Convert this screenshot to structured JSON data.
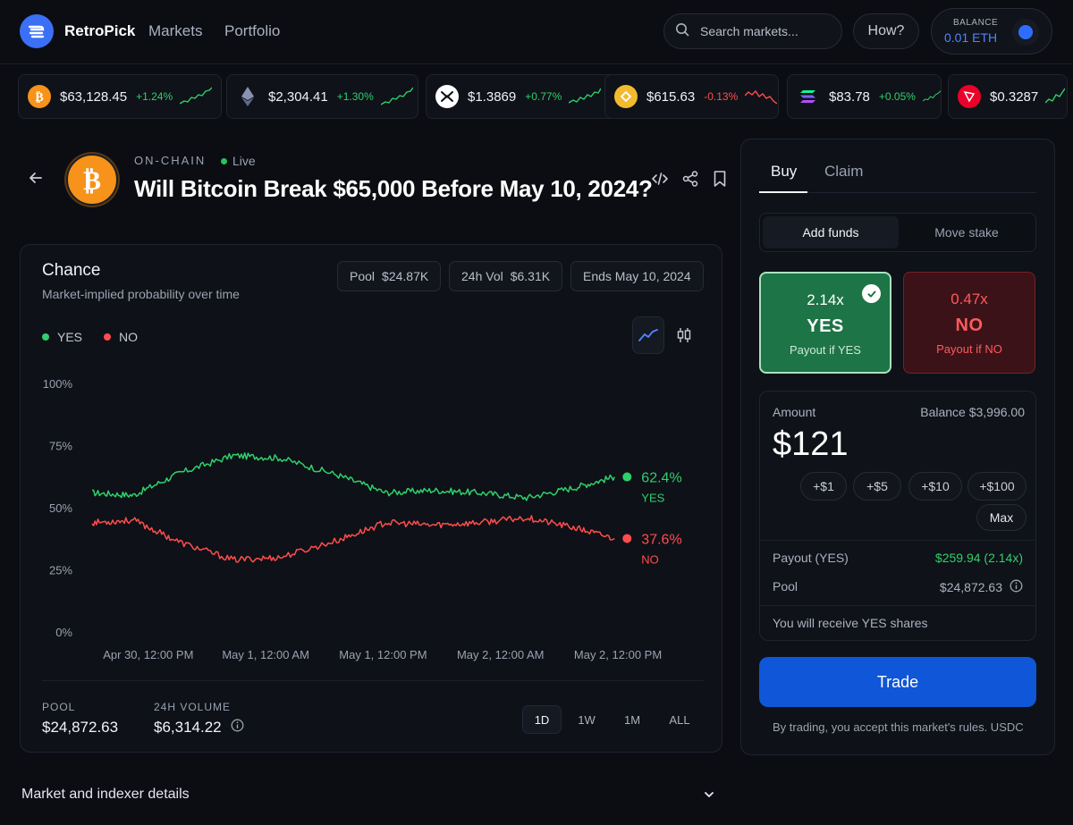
{
  "header": {
    "brand": "RetroPick",
    "nav": [
      "Markets",
      "Portfolio"
    ],
    "search_placeholder": "Search markets...",
    "how_label": "How?",
    "balance_label": "BALANCE",
    "balance_value": "0.01 ETH",
    "accent": "#3b6ff5"
  },
  "ticker": [
    {
      "icon": "bitcoin-icon",
      "price": "$63,128.45",
      "change": "+1.24%",
      "direction": "up",
      "color": "#f7931a"
    },
    {
      "icon": "ethereum-icon",
      "price": "$2,304.41",
      "change": "+1.30%",
      "direction": "up",
      "color": "#627eea"
    },
    {
      "icon": "xrp-icon",
      "price": "$1.3869",
      "change": "+0.77%",
      "direction": "up",
      "color": "#ffffff"
    },
    {
      "icon": "bnb-icon",
      "price": "$615.63",
      "change": "-0.13%",
      "direction": "down",
      "color": "#f3ba2f"
    },
    {
      "icon": "solana-icon",
      "price": "$83.78",
      "change": "+0.05%",
      "direction": "up",
      "color": "#9945ff"
    },
    {
      "icon": "tron-icon",
      "price": "$0.3287",
      "change": "",
      "direction": "up",
      "color": "#eb0029"
    }
  ],
  "market": {
    "tag": "ON-CHAIN",
    "status": "Live",
    "title": "Will Bitcoin Break $65,000 Before May 10, 2024?"
  },
  "chart_card": {
    "title": "Chance",
    "subtitle": "Market-implied probability over time",
    "pool_label": "Pool",
    "pool_value": "$24.87K",
    "vol_label": "24h Vol",
    "vol_value": "$6.31K",
    "ends_label": "Ends May 10, 2024",
    "footer_pool_label": "POOL",
    "footer_pool_value": "$24,872.63",
    "footer_vol_label": "24H VOLUME",
    "footer_vol_value": "$6,314.22",
    "ranges": [
      "1D",
      "1W",
      "1M",
      "ALL"
    ],
    "active_range": "1D"
  },
  "chart_data": {
    "type": "line",
    "legend": [
      "YES",
      "NO"
    ],
    "ylim": [
      0,
      100
    ],
    "yticks": [
      "0%",
      "25%",
      "50%",
      "75%",
      "100%"
    ],
    "xticks": [
      "Apr 30, 12:00 PM",
      "May 1, 12:00 AM",
      "May 1, 12:00 PM",
      "May 2, 12:00 AM",
      "May 2, 12:00 PM"
    ],
    "x": [
      0,
      0.35,
      0.75,
      1.2,
      1.6,
      2.1,
      2.5,
      2.9,
      3.3,
      3.7,
      4.1,
      4.45
    ],
    "series": [
      {
        "name": "YES",
        "color": "#2fd06b",
        "values": [
          56,
          55,
          64,
          71,
          70,
          63,
          56,
          57,
          56,
          54,
          58,
          62.4
        ],
        "last_label": "62.4%"
      },
      {
        "name": "NO",
        "color": "#ff4d4d",
        "values": [
          44,
          45,
          36,
          29,
          30,
          37,
          44,
          43,
          44,
          46,
          42,
          37.6
        ],
        "last_label": "37.6%"
      }
    ]
  },
  "trade": {
    "tabs": [
      "Buy",
      "Claim"
    ],
    "fund_options": [
      "Add funds",
      "Move stake"
    ],
    "yes": {
      "multiplier": "2.14x",
      "label": "YES",
      "sub": "Payout if YES"
    },
    "no": {
      "multiplier": "0.47x",
      "label": "NO",
      "sub": "Payout if NO"
    },
    "amount_label": "Amount",
    "balance_text": "Balance $3,996.00",
    "amount_value": "$121",
    "quick_amounts": [
      "+$1",
      "+$5",
      "+$10",
      "+$100"
    ],
    "max_label": "Max",
    "payout_label": "Payout (YES)",
    "payout_value": "$259.94 (2.14x)",
    "pool_label": "Pool",
    "pool_value": "$24,872.63",
    "receive_text": "You will receive YES shares",
    "trade_label": "Trade",
    "terms": "By trading, you accept this market's rules. USDC"
  },
  "details": {
    "label": "Market and indexer details"
  }
}
